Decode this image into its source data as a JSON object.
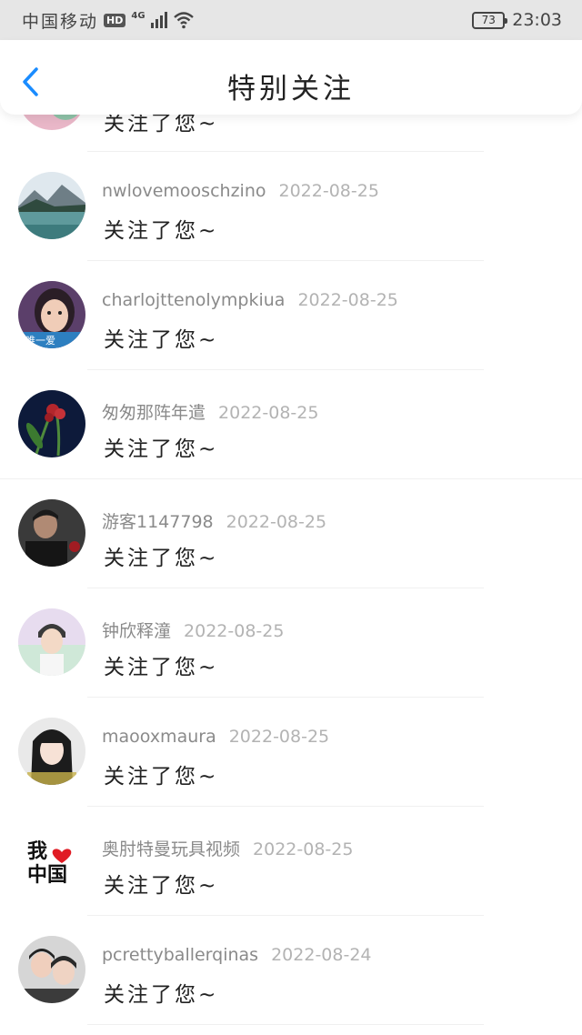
{
  "status_bar": {
    "carrier": "中国移动",
    "hd_badge": "HD",
    "network": "4G",
    "battery": "73",
    "time": "23:03"
  },
  "nav": {
    "title": "特别关注"
  },
  "partial_row": {
    "message": "关注了您~"
  },
  "rows": [
    {
      "name": "nwlovemooschzino",
      "date": "2022-08-25",
      "message": "关注了您~",
      "avatar_icon": "lake-landscape-avatar"
    },
    {
      "name": "charlojttenolympkiua",
      "date": "2022-08-25",
      "message": "关注了您~",
      "avatar_icon": "girl-portrait-avatar"
    },
    {
      "name": "匆匆那阵年遣",
      "date": "2022-08-25",
      "message": "关注了您~",
      "avatar_icon": "red-flower-avatar"
    },
    {
      "name": "游客1147798",
      "date": "2022-08-25",
      "message": "关注了您~",
      "avatar_icon": "man-portrait-avatar"
    },
    {
      "name": "钟欣释潼",
      "date": "2022-08-25",
      "message": "关注了您~",
      "avatar_icon": "boy-pastel-avatar"
    },
    {
      "name": "maooxmaura",
      "date": "2022-08-25",
      "message": "关注了您~",
      "avatar_icon": "girl-long-hair-avatar"
    },
    {
      "name": "奥肘特曼玩具视频",
      "date": "2022-08-25",
      "message": "关注了您~",
      "avatar_icon": "i-love-china-avatar"
    },
    {
      "name": "pcrettyballerqinas",
      "date": "2022-08-24",
      "message": "关注了您~",
      "avatar_icon": "couple-photo-avatar"
    }
  ],
  "avatar_texts": {
    "girl_caption": "唯一爱",
    "china_line1": "我",
    "china_line2": "中国"
  },
  "colors": {
    "accent": "#1a8cff",
    "status_bar_bg": "#e6e6e6",
    "name_text": "#8a8a8a",
    "date_text": "#b3b3b3"
  }
}
